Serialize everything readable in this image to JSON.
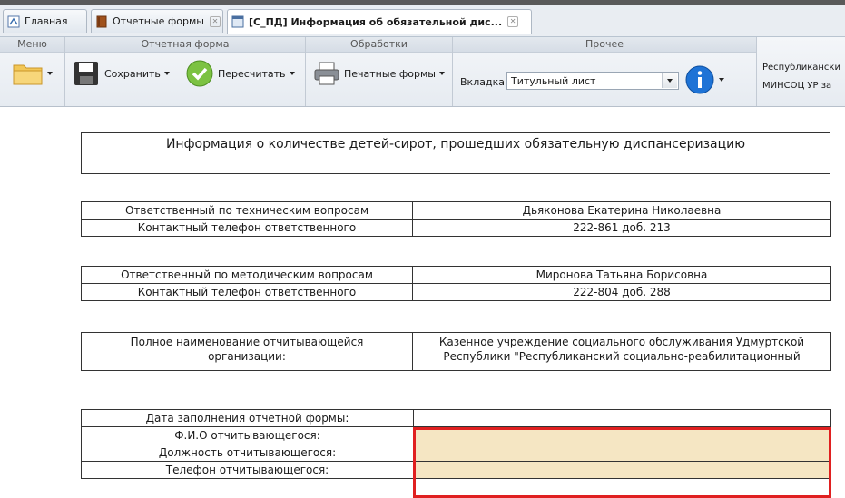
{
  "tabs": [
    {
      "label": "Главная",
      "icon": "home-icon"
    },
    {
      "label": "Отчетные формы",
      "icon": "book-icon"
    },
    {
      "label": "[С_ПД] Информация об обязательной дис...",
      "icon": "form-icon"
    }
  ],
  "ribbon": {
    "menu": {
      "title": "Меню",
      "icon": "folder-icon"
    },
    "report_form": {
      "title": "Отчетная форма",
      "save_label": "Сохранить",
      "recalc_label": "Пересчитать"
    },
    "processing": {
      "title": "Обработки",
      "print_label": "Печатные формы"
    },
    "other": {
      "title": "Прочее",
      "tab_label": "Вкладка",
      "tab_value": "Титульный лист",
      "info_icon": "info-icon"
    },
    "org": {
      "line1": "Республикански",
      "line2": "МИНСОЦ УР за"
    }
  },
  "form": {
    "title": "Информация о количестве детей-сирот, прошедших обязательную диспансеризацию",
    "tech": {
      "label1": "Ответственный по техническим вопросам",
      "value1": "Дьяконова Екатерина Николаевна",
      "label2": "Контактный телефон ответственного",
      "value2": "222-861 доб. 213"
    },
    "method": {
      "label1": "Ответственный по методическим вопросам",
      "value1": "Миронова Татьяна Борисовна",
      "label2": "Контактный телефон ответственного",
      "value2": "222-804 доб. 288"
    },
    "org": {
      "label_line1": "Полное наименование отчитывающейся",
      "label_line2": "организации:",
      "value_line1": "Казенное учреждение социального обслуживания Удмуртской",
      "value_line2": "Республики \"Республиканский социально-реабилитационный"
    },
    "filler": {
      "date_label": "Дата заполнения отчетной формы:",
      "fio_label": "Ф.И.О отчитывающегося:",
      "position_label": "Должность отчитывающегося:",
      "phone_label": "Телефон отчитывающегося:"
    }
  },
  "colors": {
    "input_fill": "#f5e6c3",
    "highlight": "#e02020"
  }
}
